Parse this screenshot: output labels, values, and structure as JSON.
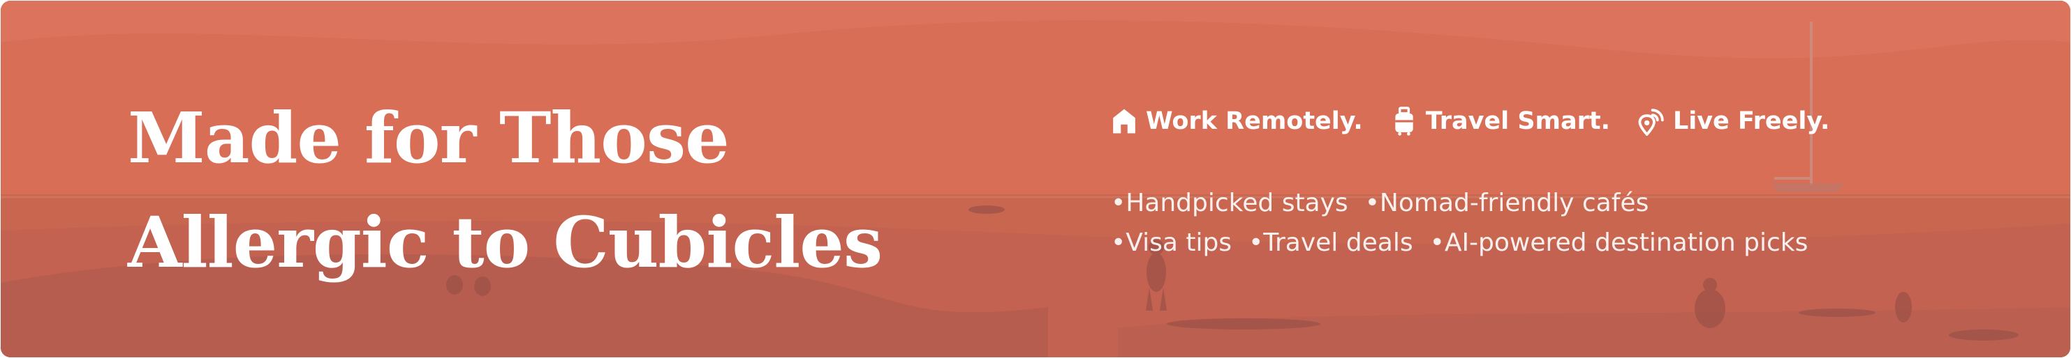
{
  "headline": {
    "line1": "Made for Those",
    "line2": "Allergic to Cubicles"
  },
  "taglines": [
    {
      "icon": "home-icon",
      "label": "Work Remotely."
    },
    {
      "icon": "luggage-icon",
      "label": "Travel Smart."
    },
    {
      "icon": "location-pin-signal-icon",
      "label": "Live Freely."
    }
  ],
  "features": {
    "row1": [
      "•Handpicked stays",
      "•Nomad-friendly cafés"
    ],
    "row2": [
      "•Visa tips",
      "•Travel deals",
      "•AI-powered destination picks"
    ]
  },
  "colors": {
    "overlay": "#d66b55",
    "text": "#ffffff"
  }
}
